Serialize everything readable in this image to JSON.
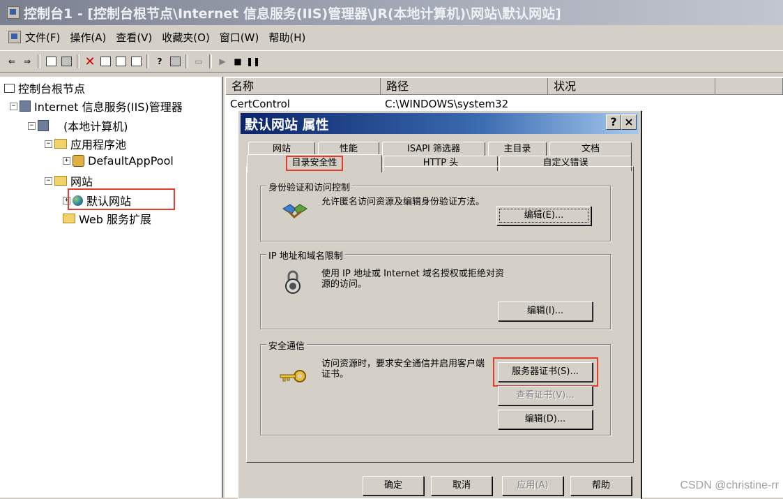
{
  "window": {
    "title": "控制台1 - [控制台根节点\\Internet 信息服务(IIS)管理器\\JR(本地计算机)\\网站\\默认网站]"
  },
  "menu": [
    "文件(F)",
    "操作(A)",
    "查看(V)",
    "收藏夹(O)",
    "窗口(W)",
    "帮助(H)"
  ],
  "tree": {
    "root": "控制台根节点",
    "iis": "Internet 信息服务(IIS)管理器",
    "computer": "(本地计算机)",
    "app_pools": "应用程序池",
    "default_app_pool": "DefaultAppPool",
    "websites": "网站",
    "default_site": "默认网站",
    "web_ext": "Web 服务扩展"
  },
  "list": {
    "columns": [
      "名称",
      "路径",
      "状况"
    ],
    "rows": [
      {
        "name": "CertControl",
        "path": "C:\\WINDOWS\\system32"
      }
    ]
  },
  "dialog": {
    "title": "默认网站 属性",
    "help_btn": "?",
    "close_btn": "×",
    "tabs_row1": [
      "网站",
      "性能",
      "ISAPI 筛选器",
      "主目录",
      "文档"
    ],
    "tabs_row2": [
      "目录安全性",
      "HTTP 头",
      "自定义错误"
    ],
    "groups": {
      "auth": {
        "title": "身份验证和访问控制",
        "desc": "允许匿名访问资源及编辑身份验证方法。",
        "button": "编辑(E)..."
      },
      "ip": {
        "title": "IP 地址和域名限制",
        "desc": "使用 IP 地址或 Internet 域名授权或拒绝对资源的访问。",
        "button": "编辑(I)..."
      },
      "secure": {
        "title": "安全通信",
        "desc": "访问资源时，要求安全通信并启用客户端证书。",
        "btn_server_cert": "服务器证书(S)...",
        "btn_view_cert": "查看证书(V)...",
        "btn_edit": "编辑(D)..."
      }
    },
    "bottom": [
      "确定",
      "取消",
      "应用(A)",
      "帮助"
    ]
  },
  "watermark": "CSDN @christine-rr"
}
